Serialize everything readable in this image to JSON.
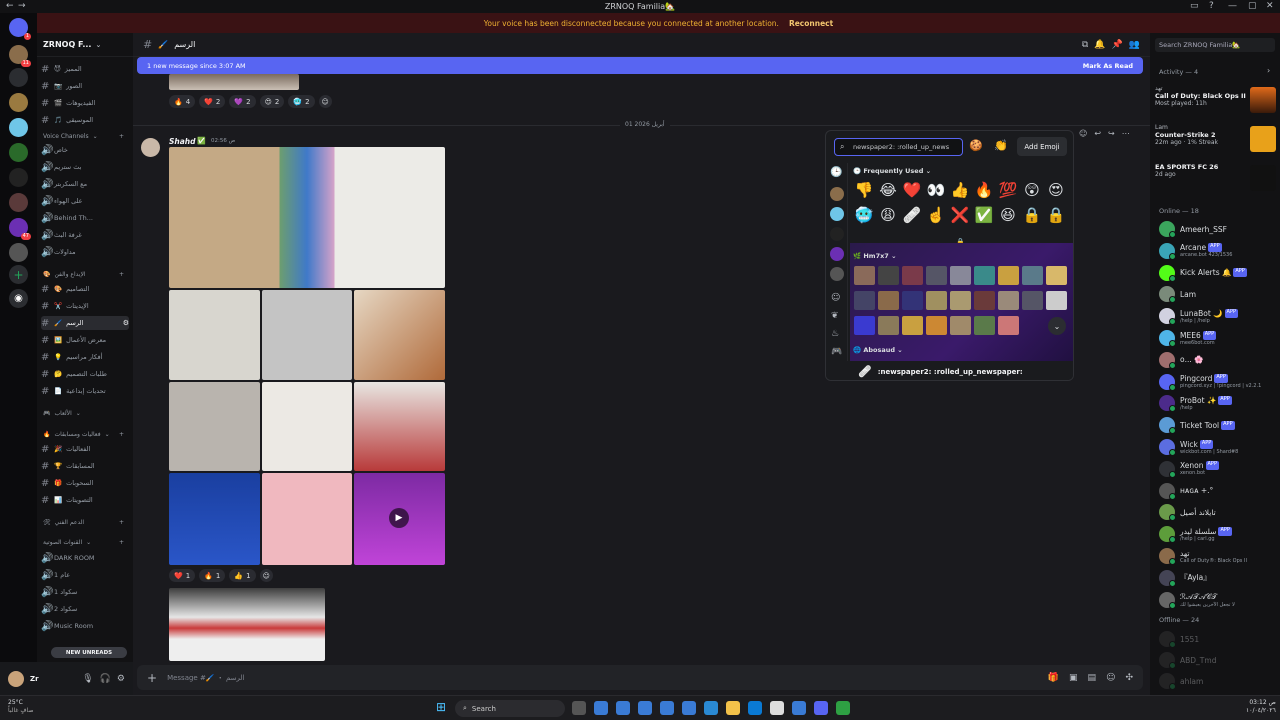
{
  "window": {
    "title": "ZRNOQ Familia🏡"
  },
  "banner": {
    "message": "Your voice has been disconnected because you connected at another location.",
    "action": "Reconnect"
  },
  "server": {
    "name": "ZRNOQ F..."
  },
  "channels": {
    "list": [
      "المميز",
      "الصور",
      "الفيديوهات",
      "الموسيقى"
    ],
    "voice_category": "Voice Channels",
    "voice": [
      "خاص",
      "بث ستريم",
      "مع السكربتر",
      "على الهواء",
      "Behind Th...",
      "غرفة البث",
      "مداولات"
    ],
    "creative_category": "الإبداع والفن",
    "creative": [
      "التصاميم",
      "الإيديتات",
      "الرسم",
      "معرض الأعمال",
      "أفكار مراسيم",
      "طلبات التصميم",
      "تحديات إبداعية"
    ],
    "games_category": "الألعاب",
    "events_category": "فعاليات ومسابقات",
    "events": [
      "الفعاليات",
      "المسابقات",
      "السحوبات",
      "التصويتات"
    ],
    "cat3": "الدعم الفني",
    "cat4": "القنوات الصوتية",
    "rooms": [
      "DARK ROOM",
      "عام 1",
      "سكواد 1",
      "سكواد 2",
      "Music Room"
    ],
    "new_unreads": "NEW UNREADS"
  },
  "header": {
    "channel_name": "الرسم"
  },
  "new_message_bar": {
    "text": "1 new message since 3:07 AM",
    "action": "Mark As Read"
  },
  "messages": {
    "top_reactions": [
      {
        "emoji": "🔥",
        "count": "4"
      },
      {
        "emoji": "❤️",
        "count": "2"
      },
      {
        "emoji": "💜",
        "count": "2"
      },
      {
        "emoji": "😍",
        "count": "2"
      },
      {
        "emoji": "🥶",
        "count": "2"
      }
    ],
    "date_divider": "01 أبريل 2026",
    "author": "Shahd",
    "timestamp": "02:56 ص",
    "gallery_reactions": [
      {
        "emoji": "❤️",
        "count": "1"
      },
      {
        "emoji": "🔥",
        "count": "1"
      },
      {
        "emoji": "👍",
        "count": "1"
      }
    ]
  },
  "composer": {
    "placeholder": "Message #🖌️ ・ الرسم"
  },
  "emoji_picker": {
    "search_value": "newspaper2: :rolled_up_news",
    "add_emoji": "Add Emoji",
    "frequently_used": "Frequently Used",
    "row1": [
      "👎",
      "😂",
      "❤️",
      "👀",
      "👍",
      "🔥",
      "💯",
      "😲",
      "😍"
    ],
    "row2": [
      "🥶",
      "😩",
      "🩹",
      "☝️",
      "❌",
      "✅",
      "😆",
      "🔒",
      "🔒"
    ],
    "section2": "Hm7x7",
    "section3": "Abosaud",
    "hover_name": ":newspaper2: :rolled_up_newspaper:"
  },
  "members": {
    "search_placeholder": "Search ZRNOQ Familia🏡",
    "activity_header": "Activity — 4",
    "activities": [
      {
        "user": "تهد",
        "game": "Call of Duty: Black Ops II",
        "detail": "Most played: 11h"
      },
      {
        "user": "Lam",
        "game": "Counter-Strike 2",
        "detail": "22m ago · 1% Streak"
      },
      {
        "user": "",
        "game": "EA SPORTS FC 26",
        "detail": "2d ago"
      }
    ],
    "online_header": "Online — 18",
    "online": [
      {
        "name": "Ameerh_SSF",
        "sub": "",
        "color": "#3ba55d"
      },
      {
        "name": "Arcane",
        "sub": "arcane.bot 423/1536",
        "app": "APP",
        "color": "#3aa5b7"
      },
      {
        "name": "Kick Alerts 🔔",
        "sub": "",
        "app": "APP",
        "color": "#53fc18"
      },
      {
        "name": "Lam",
        "sub": "",
        "color": "#7a8a7a"
      },
      {
        "name": "LunaBot 🌙",
        "sub": "/help | /help",
        "app": "APP",
        "color": "#d1d1e0"
      },
      {
        "name": "MEE6",
        "sub": "mee6bot.com",
        "app": "APP",
        "color": "#4fb5e8"
      },
      {
        "name": "ᴏ... 🌸",
        "sub": "",
        "color": "#a06e6e"
      },
      {
        "name": "Pingcord",
        "sub": "pingcord.xyz | !pingcord | v2.2.1",
        "app": "APP",
        "color": "#5865f2"
      },
      {
        "name": "ProBot ✨",
        "sub": "/help",
        "app": "APP",
        "color": "#4c2b8b"
      },
      {
        "name": "Ticket Tool",
        "sub": "",
        "app": "APP",
        "color": "#5b9bd5"
      },
      {
        "name": "Wick",
        "sub": "wickbot.com | Shard#8",
        "app": "APP",
        "color": "#5b6de0"
      },
      {
        "name": "Xenon",
        "sub": "xenon.bot",
        "app": "APP",
        "color": "#2f3136"
      },
      {
        "name": "ʜᴀɢᴀ +.°",
        "sub": "",
        "color": "#555"
      },
      {
        "name": "تايلاند أصيل",
        "sub": "",
        "color": "#6a9a4a"
      },
      {
        "name": "سلسلة ليدر",
        "sub": "/help | carl.gg",
        "app": "APP",
        "color": "#5d9d3b"
      },
      {
        "name": "تهد",
        "sub": "Call of Duty®: Black Ops II",
        "color": "#8a6a4a"
      },
      {
        "name": "『Ayla』",
        "sub": "",
        "color": "#445"
      },
      {
        "name": "ℛ𝒜𝒯𝒜𝒞𝒯",
        "sub": "لا تجعل الآخرين يعيشوا لك",
        "color": "#666"
      }
    ],
    "offline_header": "Offline — 24",
    "offline": [
      "1551",
      "ABD_Tmd",
      "ahlam"
    ]
  },
  "taskbar": {
    "weather": "25°C",
    "weather_sub": "صافٍ غالباً",
    "search": "Search",
    "time": "03:12 ص",
    "date": "١٠/٠٤/٢٠٢٦"
  }
}
